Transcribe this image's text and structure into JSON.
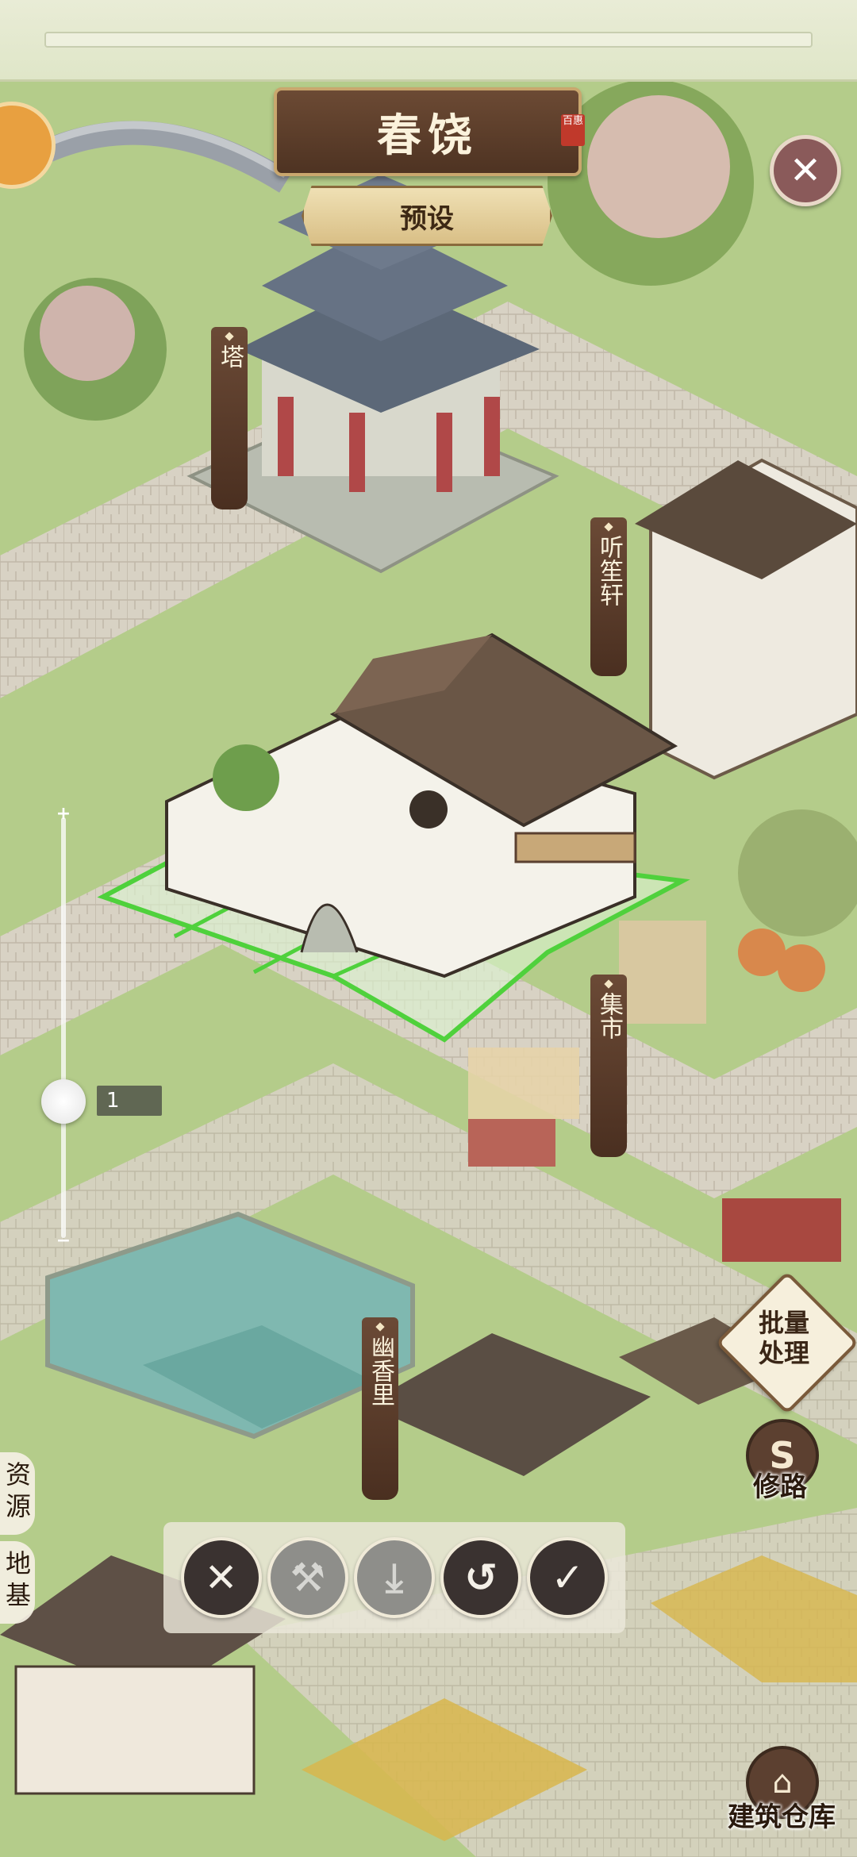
{
  "header": {
    "title": "春饶",
    "seal_text": "百惠",
    "preset_label": "预设",
    "close_symbol": "✕"
  },
  "buildings": {
    "tower": "塔",
    "tingdi": "听笙轩",
    "market": "集市",
    "youxiang": "幽香里"
  },
  "zoom": {
    "plus": "+",
    "minus": "−",
    "value": "1"
  },
  "side_tabs": {
    "resources": "资\n源",
    "foundation": "地\n基"
  },
  "right_actions": {
    "batch_label": "批量\n处理",
    "road_icon": "S",
    "road_label": "修路",
    "warehouse_icon": "⌂",
    "warehouse_label": "建筑仓库"
  },
  "toolbar": {
    "cancel": "✕",
    "demolish": "⚒",
    "store": "⤓",
    "rotate": "↺",
    "confirm": "✓"
  },
  "colors": {
    "accent_brown": "#5a3b28",
    "grass": "#a9c77c",
    "selection_green": "#4fd13c"
  }
}
